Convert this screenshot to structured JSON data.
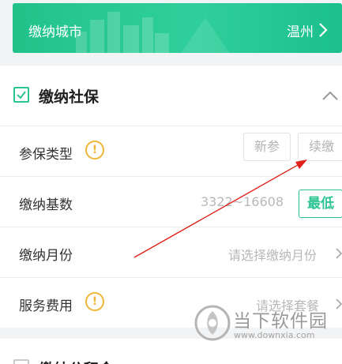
{
  "banner": {
    "label": "缴纳城市",
    "value": "温州",
    "arrow_icon": "chevron-right-icon",
    "bg_color": "#21c28a"
  },
  "section": {
    "title": "缴纳社保",
    "checkbox_icon": "checkbox-checked-icon",
    "collapse_icon": "chevron-up-icon",
    "accent_color": "#2dc493"
  },
  "rows": {
    "insurance_type": {
      "label": "参保类型",
      "info_icon": "!",
      "options": [
        "新参",
        "续缴"
      ]
    },
    "base": {
      "label": "缴纳基数",
      "range": "3322~16608",
      "min_button": "最低"
    },
    "month": {
      "label": "缴纳月份",
      "placeholder": "请选择缴纳月份"
    },
    "service_fee": {
      "label": "服务费用",
      "info_icon": "!",
      "placeholder": "请选择套餐"
    }
  },
  "next_section": {
    "title": "缴纳公积金"
  },
  "watermark": {
    "name": "当下软件园",
    "url": "www.downxia.com"
  }
}
